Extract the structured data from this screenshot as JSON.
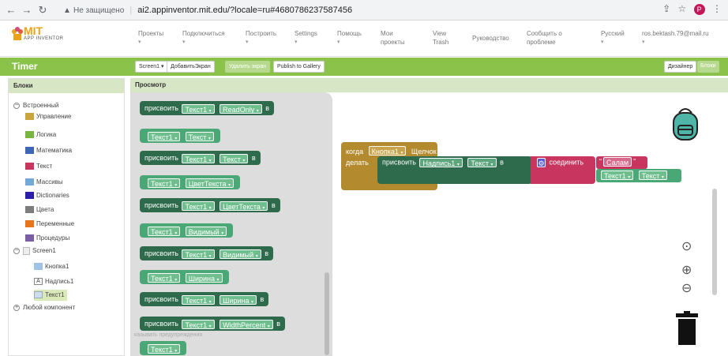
{
  "browser": {
    "back_icon": "arrow-left-icon",
    "insecure_label": "Не защищено",
    "url": "ai2.appinventor.mit.edu/?locale=ru#4680786237587456",
    "avatar_letter": "P"
  },
  "topbar": {
    "logo_text": "MIT",
    "logo_sub": "APP INVENTOR",
    "menu": [
      {
        "label": "Проекты"
      },
      {
        "label": "Подключиться"
      },
      {
        "label": "Построить"
      },
      {
        "label": "Settings"
      },
      {
        "label": "Помощь"
      },
      {
        "label": "Мои проекты"
      },
      {
        "label": "View Trash"
      },
      {
        "label": "Руководство"
      },
      {
        "label": "Сообщить о проблеме"
      },
      {
        "label": "Русский"
      }
    ],
    "email": "ros.bektash.79@mail.ru"
  },
  "toolbar": {
    "project_title": "Timer",
    "screen_select": "Screen1 ▾",
    "add_screen": "ДобавитьЭкран",
    "remove_screen": "Удалить экран",
    "publish": "Publish to Gallery",
    "designer": "Дизайнер",
    "blocks": "Блоки"
  },
  "left_panel": {
    "title": "Блоки",
    "builtin": "Встроенный",
    "categories": [
      {
        "label": "Управление",
        "color": "#c9a53b"
      },
      {
        "label": "Логика",
        "color": "#77b640"
      },
      {
        "label": "Математика",
        "color": "#3f66b5"
      },
      {
        "label": "Текст",
        "color": "#c83660"
      },
      {
        "label": "Массивы",
        "color": "#73a9d6"
      },
      {
        "label": "Dictionaries",
        "color": "#2d1eac"
      },
      {
        "label": "Цвета",
        "color": "#7d7d7d"
      },
      {
        "label": "Переменные",
        "color": "#e8751a"
      },
      {
        "label": "Процедуры",
        "color": "#7b5fa6"
      }
    ],
    "screen": "Screen1",
    "components": [
      "Кнопка1",
      "Надпись1",
      "Текст1"
    ],
    "any_component": "Любой компонент"
  },
  "viewer": {
    "title": "Просмотр",
    "flyout": {
      "set": "присвоить",
      "in": "в",
      "comp": "Текст1",
      "props": [
        "ReadOnly",
        "Текст",
        "ЦветТекста",
        "Видимый",
        "Ширина",
        "WidthPercent"
      ]
    },
    "event": {
      "when": "когда",
      "comp": "Кнопка1",
      "event": "Щелчок",
      "do": "делать"
    },
    "setter": {
      "set": "присвоить",
      "comp": "Надпись1",
      "prop": "Текст",
      "in": "в"
    },
    "join": "соединить",
    "string": "Салам",
    "getter": {
      "comp": "Текст1",
      "prop": "Текст"
    },
    "warnings": "казывать предупреждения"
  }
}
